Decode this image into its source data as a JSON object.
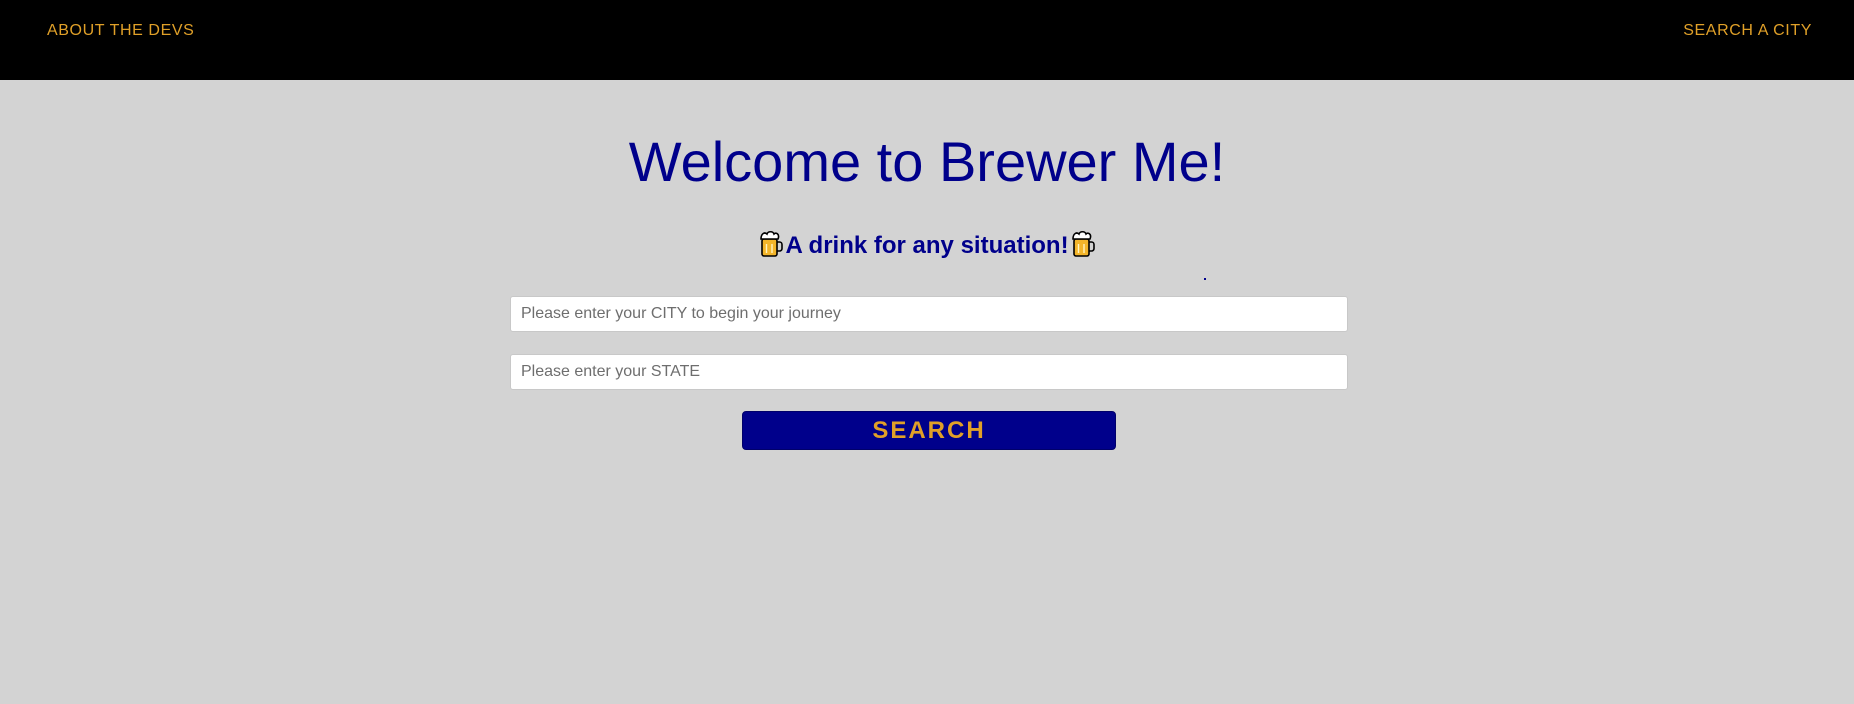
{
  "nav": {
    "about_label": "ABOUT THE DEVS",
    "search_city_label": "SEARCH A CITY"
  },
  "hero": {
    "title": "Welcome to Brewer Me!",
    "subtitle": "A drink for any situation!",
    "subtitle_icon": "beer-mug-icon"
  },
  "form": {
    "city_placeholder": "Please enter your CITY to begin your journey",
    "city_value": "",
    "state_placeholder": "Please enter your STATE",
    "state_value": "",
    "search_label": "SEARCH"
  },
  "colors": {
    "nav_background": "#000000",
    "accent_gold": "#e0a028",
    "brand_navy": "#00008b",
    "page_background": "#d3d3d3"
  }
}
